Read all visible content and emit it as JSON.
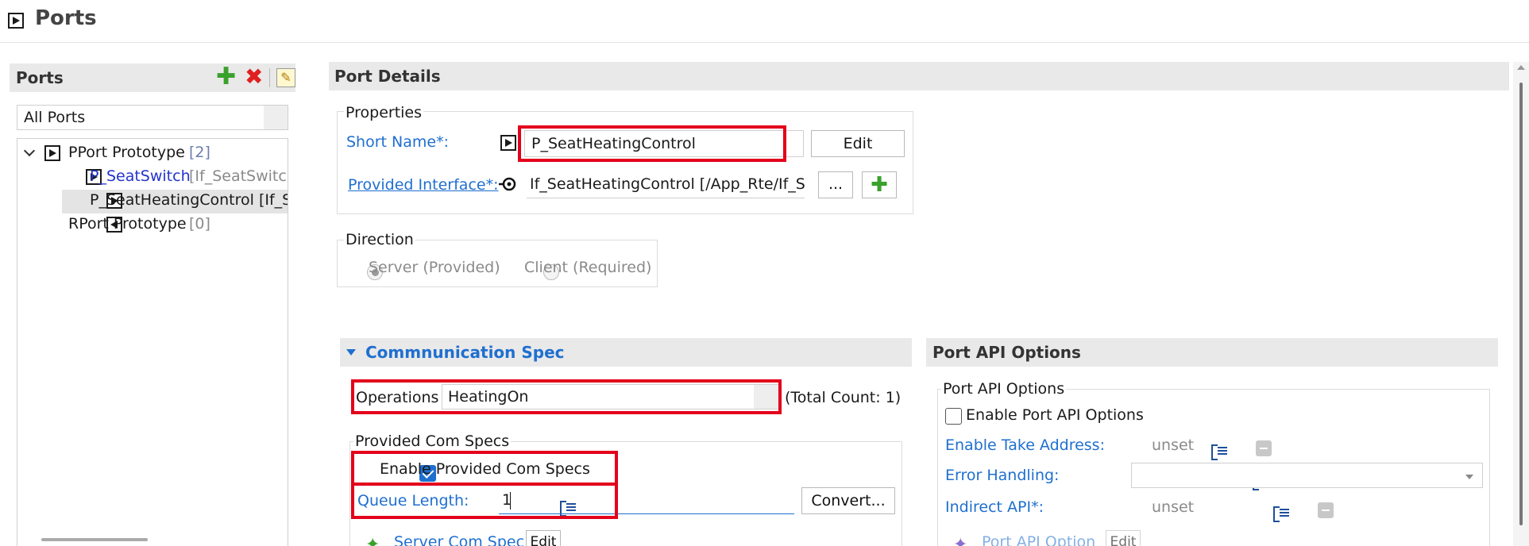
{
  "header": {
    "title": "Ports"
  },
  "left_panel": {
    "title": "Ports",
    "filter_value": "All Ports",
    "tree": {
      "pport": {
        "label": "PPort Prototype",
        "count": "[2]"
      },
      "pport_children": [
        {
          "name": "P_SeatSwitch",
          "suffix": "[If_SeatSwitch"
        },
        {
          "name": "P_SeatHeatingControl [If_Se",
          "suffix": ""
        }
      ],
      "rport": {
        "label": "RPort Prototype",
        "count": "[0]"
      }
    }
  },
  "port_details": {
    "title": "Port Details",
    "properties": {
      "legend": "Properties",
      "short_name_label": "Short Name*:",
      "short_name_value": "P_SeatHeatingControl",
      "edit_label": "Edit",
      "provided_interface_label": "Provided Interface*:",
      "provided_interface_value": "If_SeatHeatingControl [/App_Rte/If_Se",
      "browse_label": "..."
    },
    "direction": {
      "legend": "Direction",
      "server_label": "Server (Provided)",
      "client_label": "Client (Required)"
    }
  },
  "comm_spec": {
    "title": "Commnunication Spec",
    "operations_label": "Operations",
    "operations_value": "HeatingOn",
    "total_count": "(Total Count: 1)",
    "provided_com_specs": {
      "legend": "Provided Com Specs",
      "enable_label": "Enable Provided Com Specs",
      "queue_length_label": "Queue Length:",
      "queue_length_value": "1",
      "convert_label": "Convert...",
      "server_com_spec_label": "Server Com Spec",
      "server_com_spec_edit": "Edit"
    }
  },
  "port_api": {
    "title": "Port API Options",
    "legend": "Port API Options",
    "enable_label": "Enable Port API Options",
    "take_address_label": "Enable Take Address:",
    "take_address_value": "unset",
    "error_handling_label": "Error Handling:",
    "error_handling_value": "",
    "indirect_api_label": "Indirect API*:",
    "indirect_api_value": "unset",
    "port_api_option_label": "Port API Option",
    "port_api_option_edit": "Edit"
  },
  "colors": {
    "link": "#1f6fd0",
    "highlight": "#e3001b",
    "panel_header": "#e9e9e9"
  }
}
